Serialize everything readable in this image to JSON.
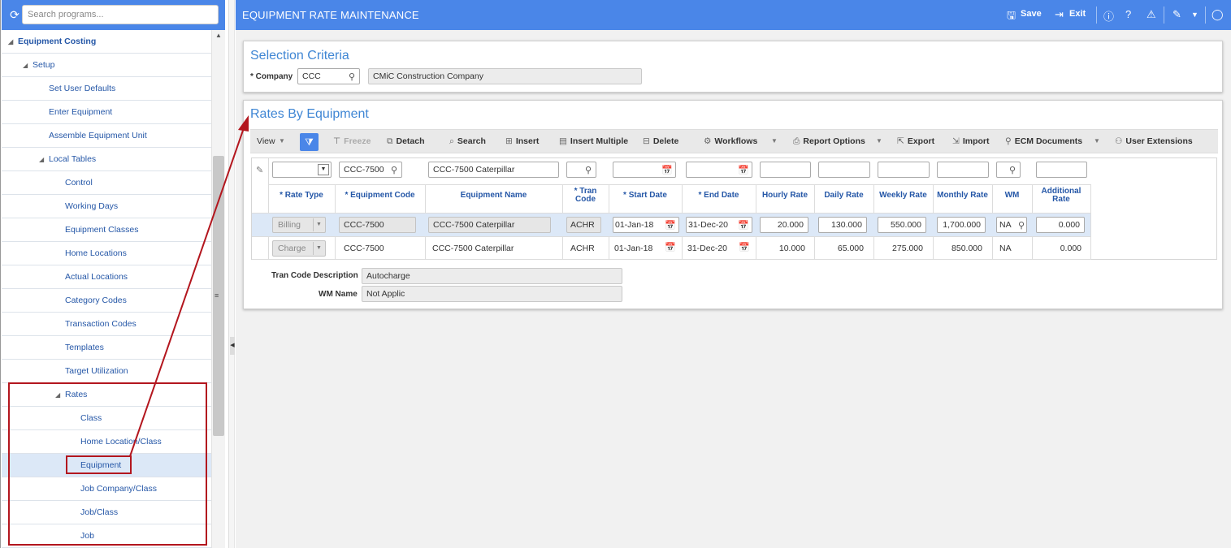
{
  "sidebar": {
    "search_placeholder": "Search programs...",
    "tree": [
      {
        "label": "Equipment Costing",
        "caret": "◢",
        "level": 0,
        "bold": true
      },
      {
        "label": "Setup",
        "caret": "◢",
        "level": 1
      },
      {
        "label": "Set User Defaults",
        "level": 2
      },
      {
        "label": "Enter Equipment",
        "level": 2
      },
      {
        "label": "Assemble Equipment Unit",
        "level": 2
      },
      {
        "label": "Local Tables",
        "caret": "◢",
        "level": 2
      },
      {
        "label": "Control",
        "level": 3
      },
      {
        "label": "Working Days",
        "level": 3
      },
      {
        "label": "Equipment Classes",
        "level": 3
      },
      {
        "label": "Home Locations",
        "level": 3
      },
      {
        "label": "Actual Locations",
        "level": 3
      },
      {
        "label": "Category Codes",
        "level": 3
      },
      {
        "label": "Transaction Codes",
        "level": 3
      },
      {
        "label": "Templates",
        "level": 3
      },
      {
        "label": "Target Utilization",
        "level": 3
      },
      {
        "label": "Rates",
        "caret": "◢",
        "level": 3
      },
      {
        "label": "Class",
        "level": 4
      },
      {
        "label": "Home Location/Class",
        "level": 4
      },
      {
        "label": "Equipment",
        "level": 4,
        "selected": true
      },
      {
        "label": "Job Company/Class",
        "level": 4
      },
      {
        "label": "Job/Class",
        "level": 4
      },
      {
        "label": "Job",
        "level": 4
      }
    ]
  },
  "header": {
    "title": "EQUIPMENT RATE MAINTENANCE",
    "save_label": "Save",
    "exit_label": "Exit"
  },
  "selection": {
    "title": "Selection Criteria",
    "company_label": "* Company",
    "company_value": "CCC",
    "company_name": "CMiC Construction Company"
  },
  "rates": {
    "title": "Rates By Equipment",
    "toolbar": {
      "view": "View",
      "freeze": "Freeze",
      "detach": "Detach",
      "search": "Search",
      "insert": "Insert",
      "insert_multiple": "Insert Multiple",
      "delete": "Delete",
      "workflows": "Workflows",
      "report_options": "Report Options",
      "export": "Export",
      "import": "Import",
      "ecm_documents": "ECM Documents",
      "user_extensions": "User Extensions"
    },
    "filters": {
      "equipment_code": "CCC-7500",
      "equipment_name": "CCC-7500 Caterpillar"
    },
    "columns": {
      "rate_type": "* Rate Type",
      "equipment_code": "* Equipment Code",
      "equipment_name": "Equipment Name",
      "tran_code_1": "* Tran",
      "tran_code_2": "Code",
      "start_date": "* Start Date",
      "end_date": "* End Date",
      "hourly_rate": "Hourly Rate",
      "daily_rate": "Daily Rate",
      "weekly_rate": "Weekly Rate",
      "monthly_rate": "Monthly Rate",
      "wm": "WM",
      "additional_rate_1": "Additional",
      "additional_rate_2": "Rate"
    },
    "rows": [
      {
        "rate_type": "Billing",
        "equipment_code": "CCC-7500",
        "equipment_name": "CCC-7500 Caterpillar",
        "tran_code": "ACHR",
        "start_date": "01-Jan-18",
        "end_date": "31-Dec-20",
        "hourly_rate": "20.000",
        "daily_rate": "130.000",
        "weekly_rate": "550.000",
        "monthly_rate": "1,700.000",
        "wm": "NA",
        "additional_rate": "0.000"
      },
      {
        "rate_type": "Charge",
        "equipment_code": "CCC-7500",
        "equipment_name": "CCC-7500 Caterpillar",
        "tran_code": "ACHR",
        "start_date": "01-Jan-18",
        "end_date": "31-Dec-20",
        "hourly_rate": "10.000",
        "daily_rate": "65.000",
        "weekly_rate": "275.000",
        "monthly_rate": "850.000",
        "wm": "NA",
        "additional_rate": "0.000"
      }
    ],
    "tran_code_description_label": "Tran Code Description",
    "tran_code_description_value": "Autocharge",
    "wm_name_label": "WM Name",
    "wm_name_value": "Not Applic"
  },
  "colors": {
    "accent": "#4a86e8",
    "title_blue": "#3f86d4",
    "annotation_red": "#b3161e"
  }
}
